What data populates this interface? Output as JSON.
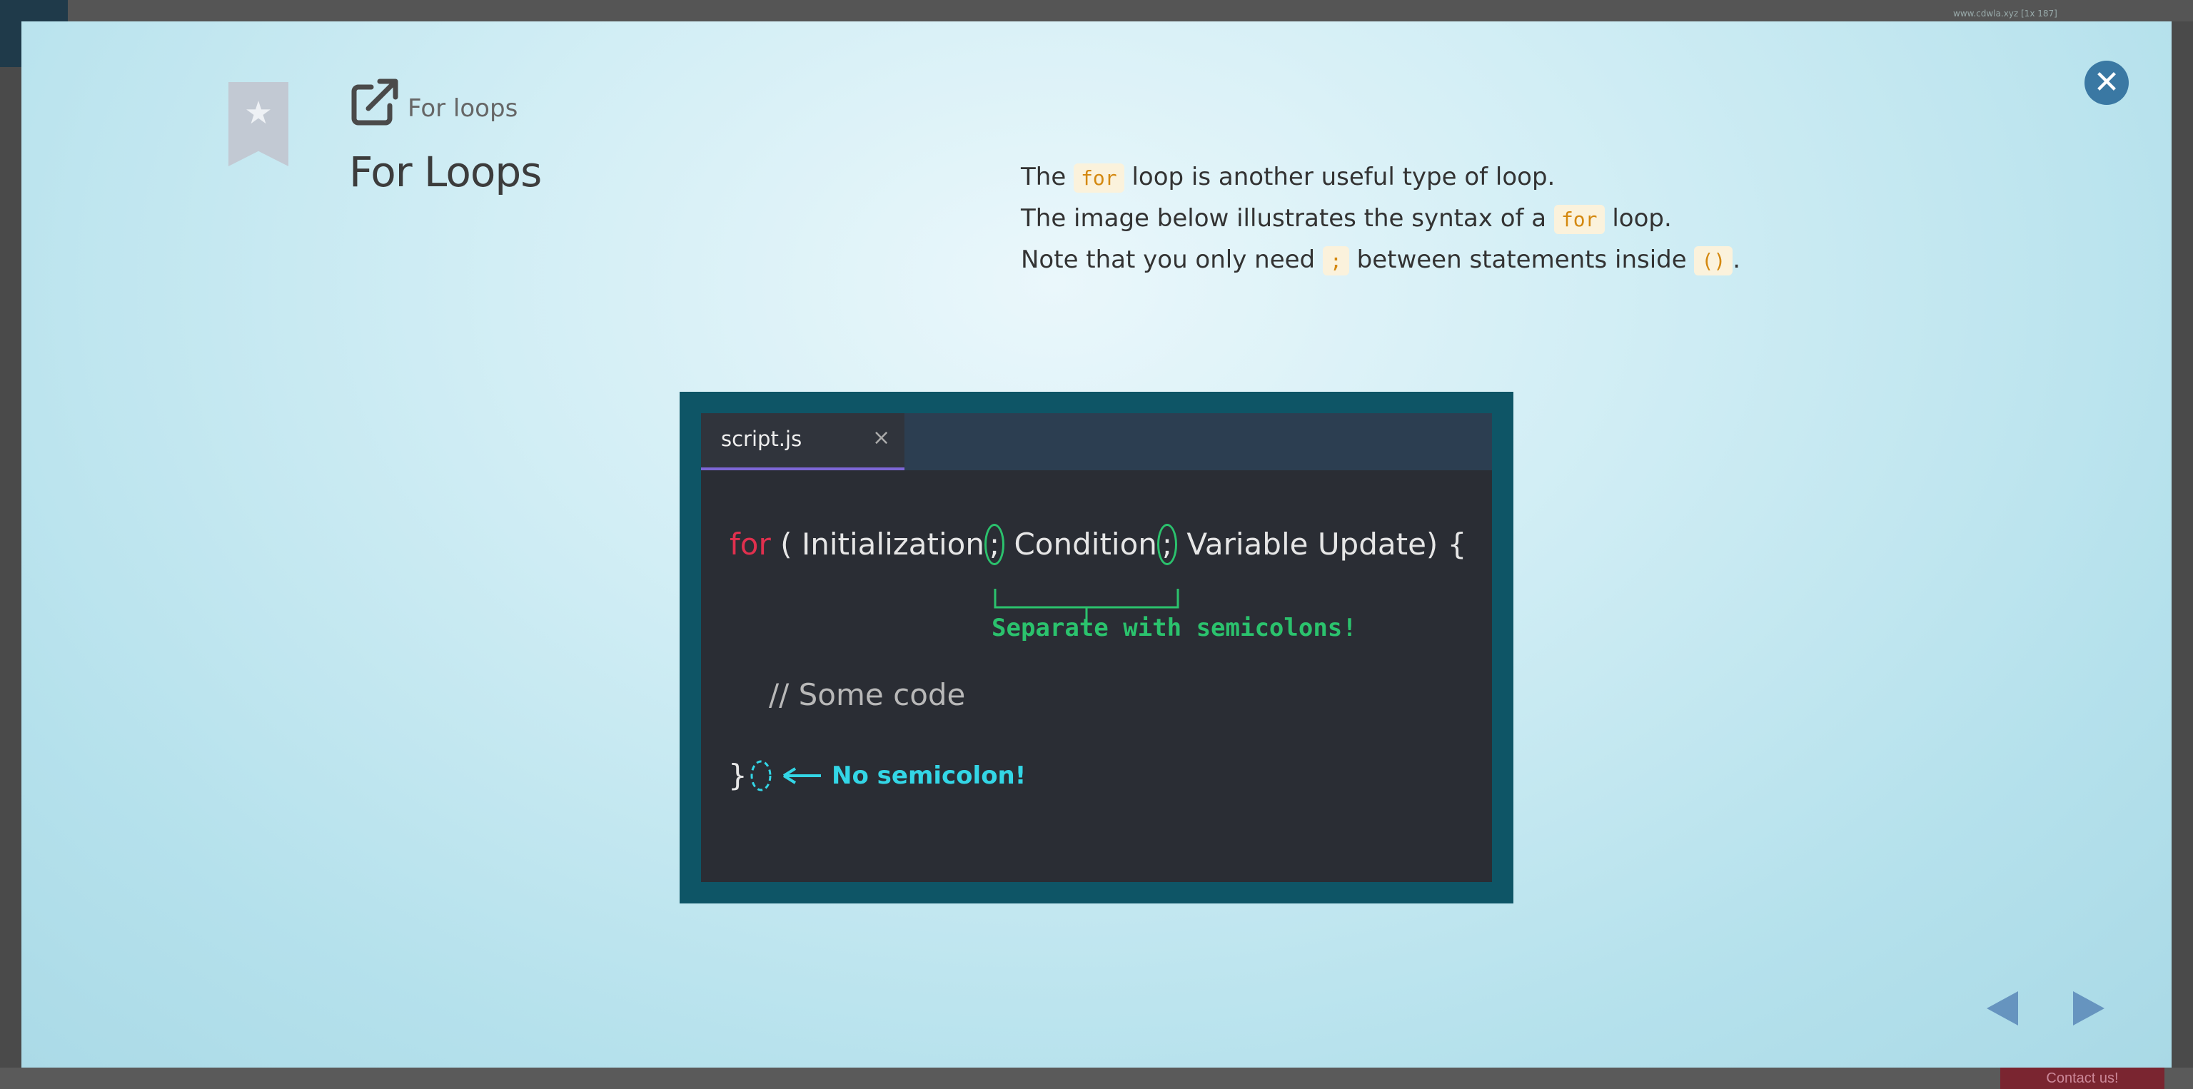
{
  "background": {
    "url_text": "www.cdwla.xyz [1x 187]",
    "contact_label": "Contact us!"
  },
  "header": {
    "breadcrumb": "For loops",
    "title": "For Loops"
  },
  "description": {
    "line1": {
      "before": "The",
      "code": "for",
      "after": "loop is another useful type of loop."
    },
    "line2": {
      "before": "The image below illustrates the syntax of a",
      "code": "for",
      "after": "loop."
    },
    "line3": {
      "before": "Note that you only need",
      "code1": ";",
      "middle": "between statements inside",
      "code2": "()",
      "after": "."
    }
  },
  "illustration": {
    "tab_name": "script.js",
    "tab_close": "×",
    "keyword": "for",
    "part_open": "( Initialization",
    "semicolon": ";",
    "part_condition": " Condition",
    "part_update": " Variable Update) {",
    "green_note": "Separate with semicolons!",
    "comment": "// Some code",
    "closing": "}",
    "cyan_note": "No semicolon!"
  },
  "colors": {
    "accent": "#3a78a3",
    "keyword": "#e0304e",
    "green": "#2bc26d",
    "cyan": "#33d6e6",
    "code_text": "#d4880f"
  },
  "icons": {
    "bookmark": "bookmark-star-icon",
    "external": "external-link-icon",
    "close": "close-icon",
    "prev": "triangle-left-icon",
    "next": "triangle-right-icon"
  }
}
